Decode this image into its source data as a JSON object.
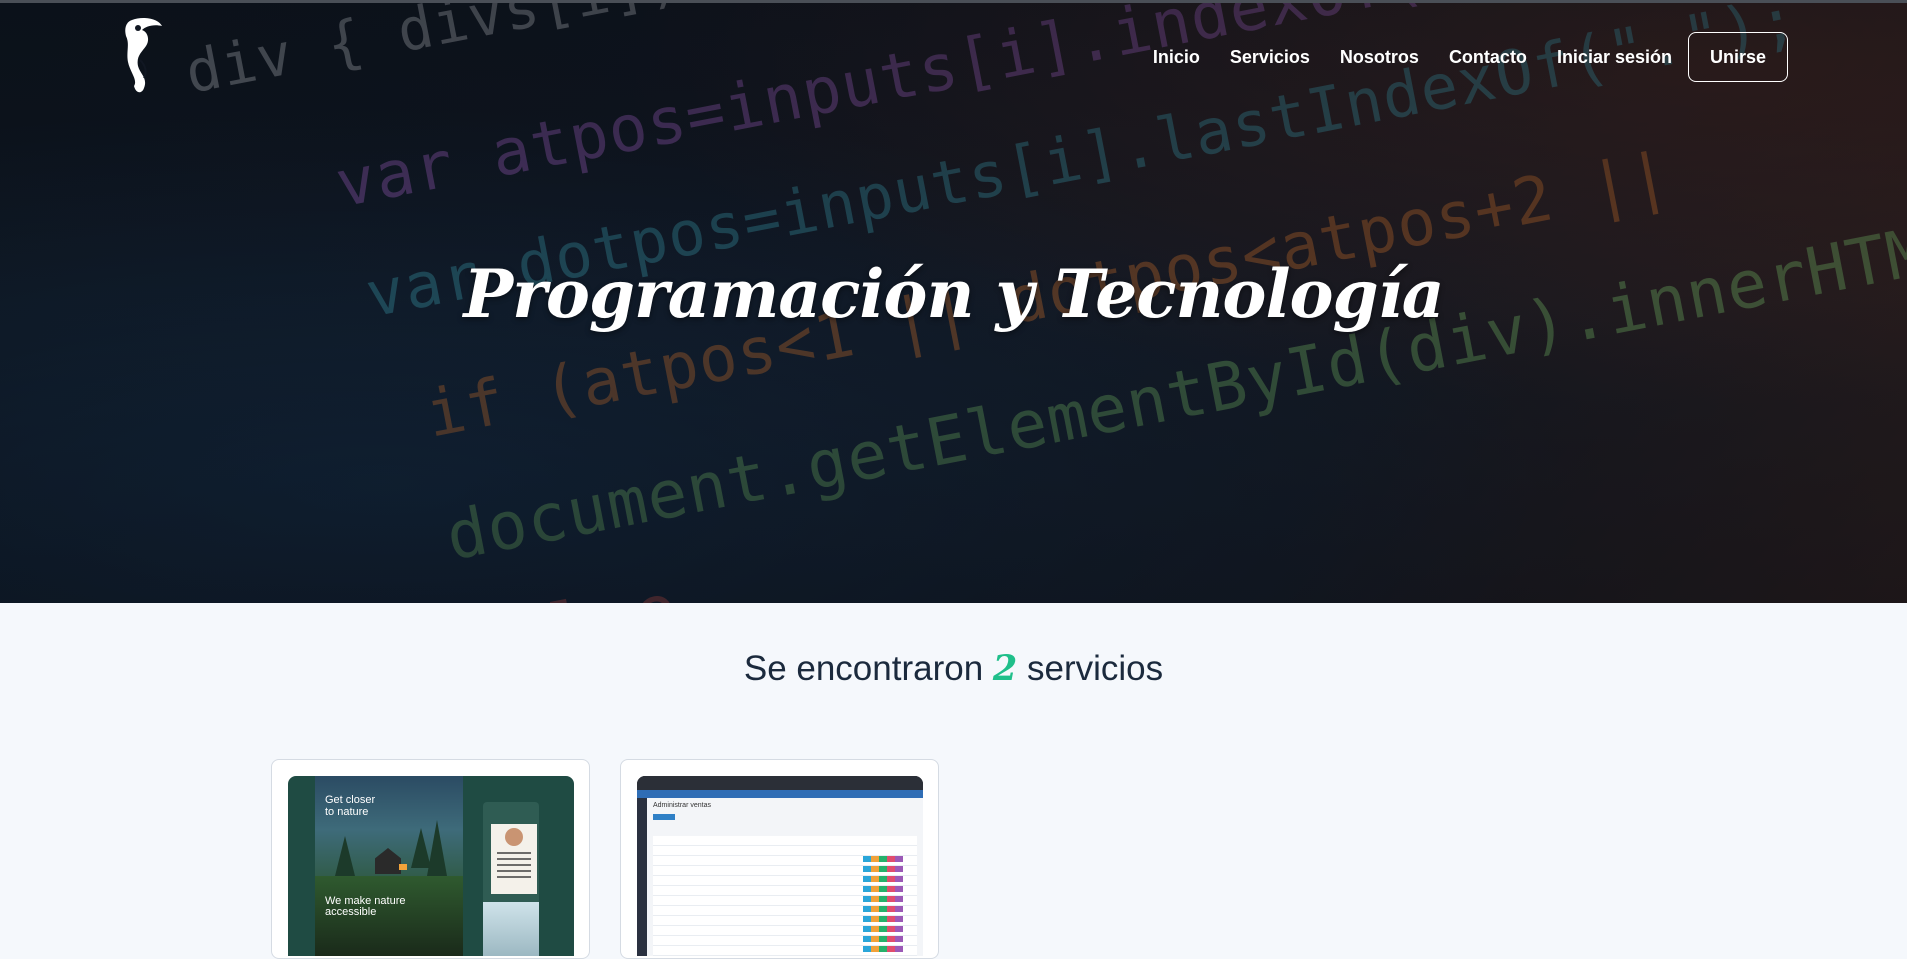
{
  "header": {
    "logo_icon": "toucan-logo-icon",
    "nav": [
      {
        "label": "Inicio"
      },
      {
        "label": "Servicios"
      },
      {
        "label": "Nosotros"
      },
      {
        "label": "Contacto"
      },
      {
        "label": "Iniciar sesión"
      }
    ],
    "join_button": "Unirse"
  },
  "hero": {
    "title": "Programación y Tecnología",
    "background_code": [
      "div { divs[i]);",
      "var atpos=inputs[i].indexOf(\"@\");",
      "var dotpos=inputs[i].lastIndexOf(\".\");",
      "if (atpos<1 || dotpos<atpos+2 ||",
      "document.getElementById(div).innerHTML",
      "else"
    ]
  },
  "results": {
    "prefix": "Se encontraron",
    "count": "2",
    "suffix": "servicios"
  },
  "cards": [
    {
      "thumb_type": "nature-website",
      "thumb_headline": "Get closer to nature",
      "thumb_tagline": "We make nature accessible"
    },
    {
      "thumb_type": "admin-dashboard",
      "thumb_title": "Administrar ventas"
    }
  ],
  "colors": {
    "accent": "#1fbf8a",
    "heading": "#1b2a3d",
    "page_bg": "#f5f8fc"
  }
}
